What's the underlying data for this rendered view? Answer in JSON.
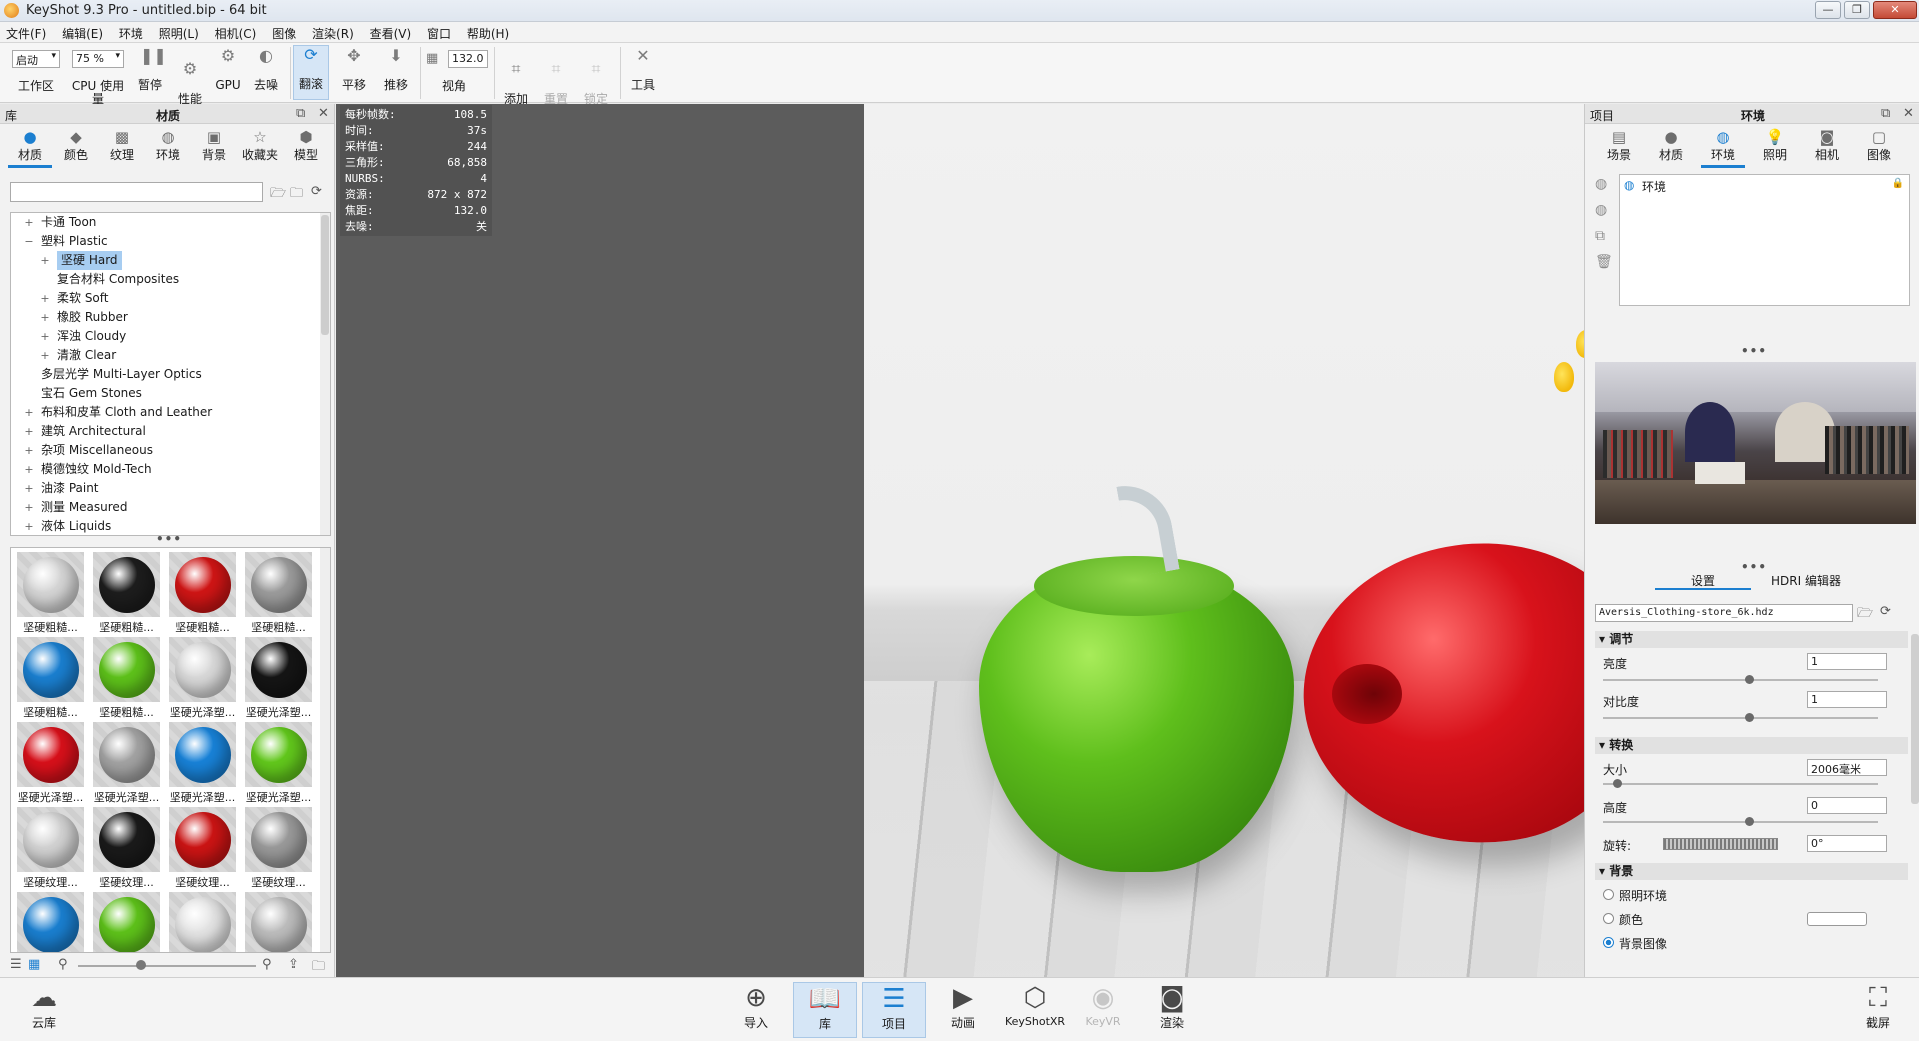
{
  "window": {
    "title": "KeyShot 9.3 Pro  - untitled.bip  - 64 bit",
    "controls": [
      "minimize",
      "maximize",
      "close"
    ]
  },
  "menu": [
    "文件(F)",
    "编辑(E)",
    "环境",
    "照明(L)",
    "相机(C)",
    "图像",
    "渲染(R)",
    "查看(V)",
    "窗口",
    "帮助(H)"
  ],
  "toolbar": {
    "workspace_value": "启动",
    "workspace_label": "工作区",
    "cpu_value": "75 %",
    "cpu_label": "CPU 使用量",
    "pause_label": "暂停",
    "perf_label": "性能\n模式",
    "gpu_label": "GPU",
    "denoise_label": "去噪",
    "tumble_label": "翻滚",
    "pan_label": "平移",
    "dolly_label": "推移",
    "fov_value": "132.0",
    "fov_label": "视角",
    "add_camera_label": "添加\n相机",
    "reset_camera_label": "重置\n相机",
    "lock_camera_label": "锁定\n相机",
    "tools_label": "工具"
  },
  "library": {
    "header_left": "库",
    "header_title": "材质",
    "tabs": [
      {
        "label": "材质",
        "icon": "material-icon",
        "active": true
      },
      {
        "label": "颜色",
        "icon": "color-icon",
        "active": false
      },
      {
        "label": "纹理",
        "icon": "texture-icon",
        "active": false
      },
      {
        "label": "环境",
        "icon": "environment-icon",
        "active": false
      },
      {
        "label": "背景",
        "icon": "background-icon",
        "active": false
      },
      {
        "label": "收藏夹",
        "icon": "favorites-icon",
        "active": false
      },
      {
        "label": "模型",
        "icon": "model-icon",
        "active": false
      }
    ],
    "search_placeholder": "",
    "tree": [
      {
        "label": "卡通 Toon",
        "level": 0,
        "expander": "+"
      },
      {
        "label": "塑料 Plastic",
        "level": 0,
        "expander": "−"
      },
      {
        "label": "坚硬 Hard",
        "level": 1,
        "expander": "+",
        "selected": true
      },
      {
        "label": "复合材料 Composites",
        "level": 1,
        "expander": ""
      },
      {
        "label": "柔软 Soft",
        "level": 1,
        "expander": "+"
      },
      {
        "label": "橡胶 Rubber",
        "level": 1,
        "expander": "+"
      },
      {
        "label": "浑浊 Cloudy",
        "level": 1,
        "expander": "+"
      },
      {
        "label": "清澈 Clear",
        "level": 1,
        "expander": "+"
      },
      {
        "label": "多层光学 Multi-Layer Optics",
        "level": 0,
        "expander": ""
      },
      {
        "label": "宝石 Gem Stones",
        "level": 0,
        "expander": ""
      },
      {
        "label": "布料和皮革 Cloth and Leather",
        "level": 0,
        "expander": "+"
      },
      {
        "label": "建筑 Architectural",
        "level": 0,
        "expander": "+"
      },
      {
        "label": "杂项 Miscellaneous",
        "level": 0,
        "expander": "+"
      },
      {
        "label": "模德蚀纹 Mold-Tech",
        "level": 0,
        "expander": "+"
      },
      {
        "label": "油漆 Paint",
        "level": 0,
        "expander": "+"
      },
      {
        "label": "测量 Measured",
        "level": 0,
        "expander": "+"
      },
      {
        "label": "液体 Liquids",
        "level": 0,
        "expander": "+"
      }
    ],
    "thumbnails": [
      {
        "label": "坚硬粗糙...",
        "color": "#d6d6d6"
      },
      {
        "label": "坚硬粗糙...",
        "color": "#1d1d1d"
      },
      {
        "label": "坚硬粗糙...",
        "color": "#d01515"
      },
      {
        "label": "坚硬粗糙...",
        "color": "#9c9c9c"
      },
      {
        "label": "坚硬粗糙...",
        "color": "#1a7fd0"
      },
      {
        "label": "坚硬粗糙...",
        "color": "#5ec21a"
      },
      {
        "label": "坚硬光泽塑...",
        "color": "#d9d9d9"
      },
      {
        "label": "坚硬光泽塑...",
        "color": "#151515"
      },
      {
        "label": "坚硬光泽塑...",
        "color": "#d8101a"
      },
      {
        "label": "坚硬光泽塑...",
        "color": "#a3a3a3"
      },
      {
        "label": "坚硬光泽塑...",
        "color": "#1882d8"
      },
      {
        "label": "坚硬光泽塑...",
        "color": "#62c81c"
      },
      {
        "label": "坚硬纹理...",
        "color": "#d3d3d3"
      },
      {
        "label": "坚硬纹理...",
        "color": "#1a1a1a"
      },
      {
        "label": "坚硬纹理...",
        "color": "#cc1414"
      },
      {
        "label": "坚硬纹理...",
        "color": "#9a9a9a"
      },
      {
        "label": "",
        "color": "#1a7fd0"
      },
      {
        "label": "",
        "color": "#5ec21a"
      },
      {
        "label": "",
        "color": "#e4e4e4"
      },
      {
        "label": "",
        "color": "#bdbdbd"
      }
    ]
  },
  "viewport": {
    "stats": [
      {
        "key": "每秒帧数:",
        "value": "108.5"
      },
      {
        "key": "时间:",
        "value": "37s"
      },
      {
        "key": "采样值:",
        "value": "244"
      },
      {
        "key": "三角形:",
        "value": "68,858"
      },
      {
        "key": "NURBS:",
        "value": "4"
      },
      {
        "key": "资源:",
        "value": "872 x 872"
      },
      {
        "key": "焦距:",
        "value": "132.0"
      },
      {
        "key": "去噪:",
        "value": "关"
      }
    ]
  },
  "project": {
    "header_left": "项目",
    "header_title": "环境",
    "tabs": [
      {
        "label": "场景",
        "icon": "scene-icon",
        "active": false
      },
      {
        "label": "材质",
        "icon": "material-icon",
        "active": false
      },
      {
        "label": "环境",
        "icon": "environment-icon",
        "active": true
      },
      {
        "label": "照明",
        "icon": "lighting-icon",
        "active": false
      },
      {
        "label": "相机",
        "icon": "camera-icon",
        "active": false
      },
      {
        "label": "图像",
        "icon": "image-icon",
        "active": false
      }
    ],
    "env_item": "环境",
    "subtabs": [
      "设置",
      "HDRI 编辑器"
    ],
    "hdr_file": "Aversis_Clothing-store_6k.hdz",
    "sections": {
      "adjust": "调节",
      "transform": "转换",
      "background": "背景"
    },
    "brightness_label": "亮度",
    "brightness_value": "1",
    "contrast_label": "对比度",
    "contrast_value": "1",
    "size_label": "大小",
    "size_value": "2006毫米",
    "height_label": "高度",
    "height_value": "0",
    "rotation_label": "旋转:",
    "rotation_value": "0°",
    "bg_options": [
      {
        "label": "照明环境",
        "selected": false
      },
      {
        "label": "颜色",
        "selected": false
      },
      {
        "label": "背景图像",
        "selected": true
      }
    ]
  },
  "bottombar": {
    "cloud_label": "云库",
    "items": [
      {
        "label": "导入",
        "icon": "import-icon",
        "active": false,
        "disabled": false
      },
      {
        "label": "库",
        "icon": "library-icon",
        "active": true,
        "disabled": false
      },
      {
        "label": "项目",
        "icon": "project-icon",
        "active": true,
        "disabled": false
      },
      {
        "label": "动画",
        "icon": "animation-icon",
        "active": false,
        "disabled": false
      },
      {
        "label": "KeyShotXR",
        "icon": "keyshotxr-icon",
        "active": false,
        "disabled": false
      },
      {
        "label": "KeyVR",
        "icon": "keyvr-icon",
        "active": false,
        "disabled": true
      },
      {
        "label": "渲染",
        "icon": "render-icon",
        "active": false,
        "disabled": false
      }
    ],
    "screenshot_label": "截屏"
  },
  "colors": {
    "accent": "#1c7fd0",
    "selection": "#a7cdf1",
    "viewport_bg": "#5c5c5c"
  }
}
